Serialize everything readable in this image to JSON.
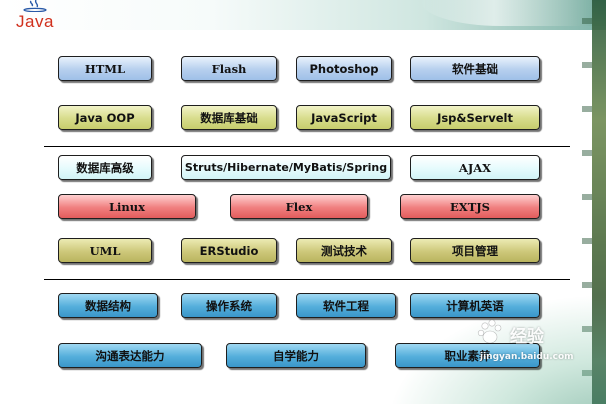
{
  "logo": {
    "text": "Java"
  },
  "rows": {
    "row1": [
      "HTML",
      "Flash",
      "Photoshop",
      "软件基础"
    ],
    "row2": [
      "Java OOP",
      "数据库基础",
      "JavaScript",
      "Jsp&Servelt"
    ],
    "row3": [
      "数据库高级",
      "Struts/Hibernate/MyBatis/Spring",
      "AJAX"
    ],
    "row4": [
      "Linux",
      "Flex",
      "EXTJS"
    ],
    "row5": [
      "UML",
      "ERStudio",
      "测试技术",
      "项目管理"
    ],
    "row6": [
      "数据结构",
      "操作系统",
      "软件工程",
      "计算机英语"
    ],
    "row7": [
      "沟通表达能力",
      "自学能力",
      "职业素养"
    ]
  },
  "watermark": {
    "brand": "经验",
    "url": "jingyan.baidu.com"
  },
  "colors": {
    "logo_red": "#d0301d",
    "blue": "#b6cfee",
    "olive": "#d7dc8b",
    "cyan": "#e5fbfd",
    "red": "#f07f7f",
    "khaki": "#cdc87a",
    "navy": "#54aedb"
  }
}
